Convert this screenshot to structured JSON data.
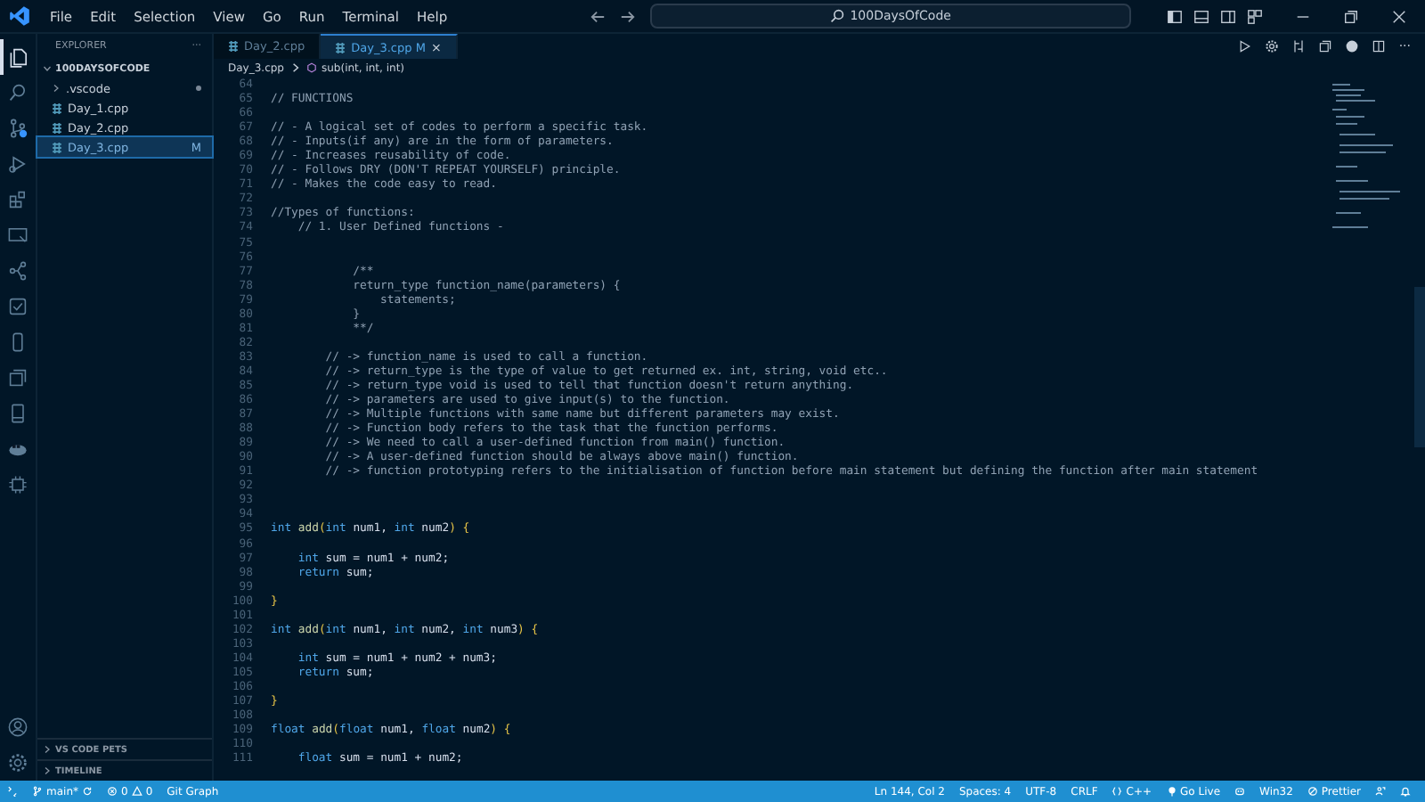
{
  "title_bar": {
    "menu": [
      "File",
      "Edit",
      "Selection",
      "View",
      "Go",
      "Run",
      "Terminal",
      "Help"
    ],
    "search": {
      "value": "100DaysOfCode"
    }
  },
  "activity_bar": {
    "items": [
      {
        "kind": "files",
        "selected": true
      },
      {
        "kind": "search",
        "selected": false
      },
      {
        "kind": "source-control",
        "selected": false
      },
      {
        "kind": "run",
        "selected": false
      },
      {
        "kind": "extensions",
        "selected": false
      },
      {
        "kind": "remote",
        "selected": false
      },
      {
        "kind": "git-graph",
        "selected": false
      },
      {
        "kind": "testing",
        "selected": false
      },
      {
        "kind": "phone",
        "selected": false
      },
      {
        "kind": "stack",
        "selected": false
      },
      {
        "kind": "book",
        "selected": false
      },
      {
        "kind": "docker",
        "selected": false
      },
      {
        "kind": "chip",
        "selected": false
      }
    ]
  },
  "sidebar": {
    "title": "EXPLORER",
    "more": "···",
    "folder": "100DAYSOFCODE",
    "items": [
      {
        "kind": "folder",
        "label": ".vscode",
        "selected": false
      },
      {
        "kind": "file",
        "label": "Day_1.cpp",
        "selected": false
      },
      {
        "kind": "file",
        "label": "Day_2.cpp",
        "selected": false
      },
      {
        "kind": "file",
        "label": "Day_3.cpp",
        "selected": true,
        "badge": "M"
      }
    ],
    "panels": [
      "VS CODE PETS",
      "TIMELINE"
    ]
  },
  "tabs": [
    {
      "label": "Day_2.cpp",
      "selected": false
    },
    {
      "label": "Day_3.cpp",
      "badge": "M",
      "close": "×",
      "selected": true
    }
  ],
  "breadcrumb": [
    "Day_3.cpp",
    "sub(int, int, int)"
  ],
  "editor": {
    "more": "···",
    "lines": [
      {
        "n": "64"
      },
      {
        "n": "65",
        "tokens": [
          {
            "kind": "comment",
            "t": "// FUNCTIONS"
          }
        ]
      },
      {
        "n": "66"
      },
      {
        "n": "67",
        "tokens": [
          {
            "kind": "comment",
            "t": "// - A logical set of codes to perform a specific task."
          }
        ]
      },
      {
        "n": "68",
        "tokens": [
          {
            "kind": "comment",
            "t": "// - Inputs(if any) are in the form of parameters."
          }
        ]
      },
      {
        "n": "69",
        "tokens": [
          {
            "kind": "comment",
            "t": "// - Increases reusability of code."
          }
        ]
      },
      {
        "n": "70",
        "tokens": [
          {
            "kind": "comment",
            "t": "// - Follows DRY (DON'T REPEAT YOURSELF) principle."
          }
        ]
      },
      {
        "n": "71",
        "tokens": [
          {
            "kind": "comment",
            "t": "// - Makes the code easy to read."
          }
        ]
      },
      {
        "n": "72"
      },
      {
        "n": "73",
        "tokens": [
          {
            "kind": "comment",
            "t": "//Types of functions:"
          }
        ]
      },
      {
        "n": "74",
        "tokens": [
          {
            "kind": "comment",
            "t": "    // 1. User Defined functions -"
          }
        ]
      },
      {
        "n": "75"
      },
      {
        "n": "76"
      },
      {
        "n": "77",
        "tokens": [
          {
            "kind": "comment",
            "t": "            /**"
          }
        ]
      },
      {
        "n": "78",
        "tokens": [
          {
            "kind": "comment",
            "t": "            return_type function_name(parameters) {"
          }
        ]
      },
      {
        "n": "79",
        "tokens": [
          {
            "kind": "comment",
            "t": "                statements;"
          }
        ]
      },
      {
        "n": "80",
        "tokens": [
          {
            "kind": "comment",
            "t": "            }"
          }
        ]
      },
      {
        "n": "81",
        "tokens": [
          {
            "kind": "comment",
            "t": "            **/"
          }
        ]
      },
      {
        "n": "82"
      },
      {
        "n": "83",
        "tokens": [
          {
            "kind": "comment",
            "t": "        // -> function_name is used to call a function."
          }
        ]
      },
      {
        "n": "84",
        "tokens": [
          {
            "kind": "comment",
            "t": "        // -> return_type is the type of value to get returned ex. int, string, void etc.."
          }
        ]
      },
      {
        "n": "85",
        "tokens": [
          {
            "kind": "comment",
            "t": "        // -> return_type void is used to tell that function doesn't return anything."
          }
        ]
      },
      {
        "n": "86",
        "tokens": [
          {
            "kind": "comment",
            "t": "        // -> parameters are used to give input(s) to the function."
          }
        ]
      },
      {
        "n": "87",
        "tokens": [
          {
            "kind": "comment",
            "t": "        // -> Multiple functions with same name but different parameters may exist."
          }
        ]
      },
      {
        "n": "88",
        "tokens": [
          {
            "kind": "comment",
            "t": "        // -> Function body refers to the task that the function performs."
          }
        ]
      },
      {
        "n": "89",
        "tokens": [
          {
            "kind": "comment",
            "t": "        // -> We need to call a user-defined function from main() function."
          }
        ]
      },
      {
        "n": "90",
        "tokens": [
          {
            "kind": "comment",
            "t": "        // -> A user-defined function should be always above main() function."
          }
        ]
      },
      {
        "n": "91",
        "tokens": [
          {
            "kind": "comment",
            "t": "        // -> function prototyping refers to the initialisation of function before main statement but defining the function after main statement"
          }
        ]
      },
      {
        "n": "92"
      },
      {
        "n": "93"
      },
      {
        "n": "94"
      },
      {
        "n": "95",
        "tokens": [
          {
            "kind": "type",
            "t": "int "
          },
          {
            "kind": "func",
            "t": "add"
          },
          {
            "kind": "bracket",
            "t": "("
          },
          {
            "kind": "type",
            "t": "int "
          },
          {
            "kind": "var",
            "t": "num1, "
          },
          {
            "kind": "type",
            "t": "int "
          },
          {
            "kind": "var",
            "t": "num2"
          },
          {
            "kind": "bracket",
            "t": ") {"
          }
        ]
      },
      {
        "n": "96"
      },
      {
        "n": "97",
        "tokens": [
          {
            "kind": "type",
            "t": "    int "
          },
          {
            "kind": "var",
            "t": "sum = num1 + num2;"
          }
        ]
      },
      {
        "n": "98",
        "tokens": [
          {
            "kind": "keyword",
            "t": "    return "
          },
          {
            "kind": "var",
            "t": "sum;"
          }
        ]
      },
      {
        "n": "99"
      },
      {
        "n": "100",
        "tokens": [
          {
            "kind": "bracket",
            "t": "}"
          }
        ]
      },
      {
        "n": "101"
      },
      {
        "n": "102",
        "tokens": [
          {
            "kind": "type",
            "t": "int "
          },
          {
            "kind": "func",
            "t": "add"
          },
          {
            "kind": "bracket",
            "t": "("
          },
          {
            "kind": "type",
            "t": "int "
          },
          {
            "kind": "var",
            "t": "num1, "
          },
          {
            "kind": "type",
            "t": "int "
          },
          {
            "kind": "var",
            "t": "num2, "
          },
          {
            "kind": "type",
            "t": "int "
          },
          {
            "kind": "var",
            "t": "num3"
          },
          {
            "kind": "bracket",
            "t": ") {"
          }
        ]
      },
      {
        "n": "103"
      },
      {
        "n": "104",
        "tokens": [
          {
            "kind": "type",
            "t": "    int "
          },
          {
            "kind": "var",
            "t": "sum = num1 + num2 + num3;"
          }
        ]
      },
      {
        "n": "105",
        "tokens": [
          {
            "kind": "keyword",
            "t": "    return "
          },
          {
            "kind": "var",
            "t": "sum;"
          }
        ]
      },
      {
        "n": "106"
      },
      {
        "n": "107",
        "tokens": [
          {
            "kind": "bracket",
            "t": "}"
          }
        ]
      },
      {
        "n": "108"
      },
      {
        "n": "109",
        "tokens": [
          {
            "kind": "type",
            "t": "float "
          },
          {
            "kind": "func",
            "t": "add"
          },
          {
            "kind": "bracket",
            "t": "("
          },
          {
            "kind": "type",
            "t": "float "
          },
          {
            "kind": "var",
            "t": "num1, "
          },
          {
            "kind": "type",
            "t": "float "
          },
          {
            "kind": "var",
            "t": "num2"
          },
          {
            "kind": "bracket",
            "t": ") {"
          }
        ]
      },
      {
        "n": "110"
      },
      {
        "n": "111",
        "tokens": [
          {
            "kind": "type",
            "t": "    float "
          },
          {
            "kind": "var",
            "t": "sum = num1 + num2;"
          }
        ]
      }
    ]
  },
  "status_bar": {
    "branch": "main*",
    "errors": "0",
    "warnings": "0",
    "git_graph": "Git Graph",
    "right": [
      {
        "kind": "text",
        "label": "Ln 144, Col 2"
      },
      {
        "kind": "text",
        "label": "Spaces: 4"
      },
      {
        "kind": "text",
        "label": "UTF-8"
      },
      {
        "kind": "text",
        "label": "CRLF"
      },
      {
        "kind": "braces",
        "label": "C++"
      },
      {
        "kind": "golive",
        "label": "Go Live"
      },
      {
        "kind": "copilot"
      },
      {
        "kind": "text",
        "label": "Win32"
      },
      {
        "kind": "prettier",
        "label": "Prettier"
      },
      {
        "kind": "feedback"
      },
      {
        "kind": "bell"
      }
    ]
  }
}
